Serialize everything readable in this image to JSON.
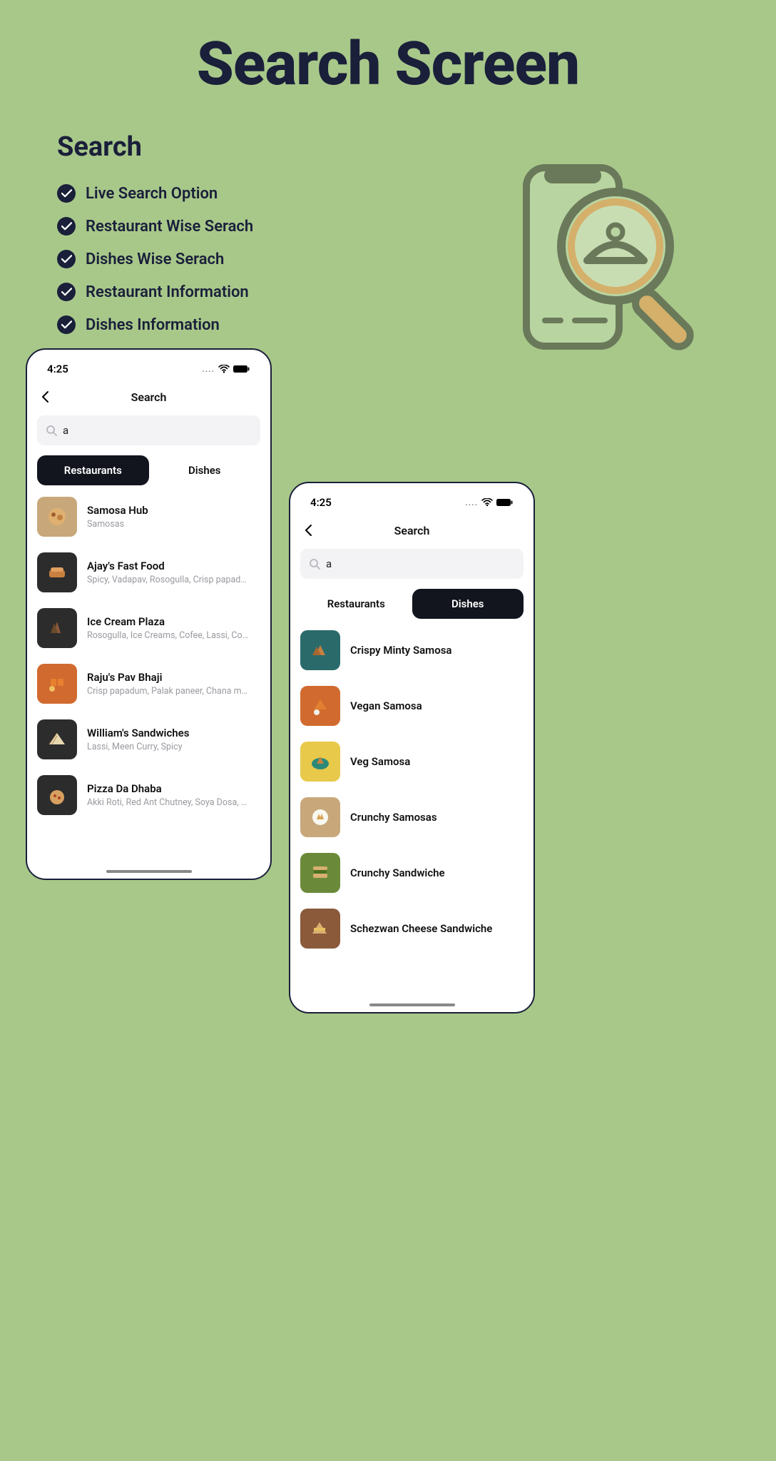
{
  "page": {
    "title": "Search Screen",
    "section": "Search",
    "features": [
      "Live Search Option",
      "Restaurant Wise Serach",
      "Dishes Wise Serach",
      "Restaurant Information",
      "Dishes Information"
    ]
  },
  "phone_left": {
    "status_time": "4:25",
    "header_title": "Search",
    "search_value": "a",
    "tabs": {
      "restaurants": "Restaurants",
      "dishes": "Dishes",
      "active": "restaurants"
    },
    "items": [
      {
        "title": "Samosa Hub",
        "subtitle": "Samosas"
      },
      {
        "title": "Ajay's Fast Food",
        "subtitle": "Spicy, Vadapav, Rosogulla, Crisp papadum..."
      },
      {
        "title": "Ice Cream Plaza",
        "subtitle": "Rosogulla, Ice Creams, Cofee, Lassi, Coco"
      },
      {
        "title": "Raju's Pav Bhaji",
        "subtitle": "Crisp papadum, Palak paneer, Chana mas..."
      },
      {
        "title": "William's Sandwiches",
        "subtitle": "Lassi, Meen Curry, Spicy"
      },
      {
        "title": "Pizza Da Dhaba",
        "subtitle": "Akki Roti, Red Ant Chutney, Soya Dosa, La..."
      }
    ]
  },
  "phone_right": {
    "status_time": "4:25",
    "header_title": "Search",
    "search_value": "a",
    "tabs": {
      "restaurants": "Restaurants",
      "dishes": "Dishes",
      "active": "dishes"
    },
    "items": [
      {
        "title": "Crispy Minty Samosa"
      },
      {
        "title": "Vegan Samosa"
      },
      {
        "title": "Veg Samosa"
      },
      {
        "title": "Crunchy Samosas"
      },
      {
        "title": "Crunchy Sandwiche"
      },
      {
        "title": "Schezwan Cheese Sandwiche"
      }
    ]
  }
}
